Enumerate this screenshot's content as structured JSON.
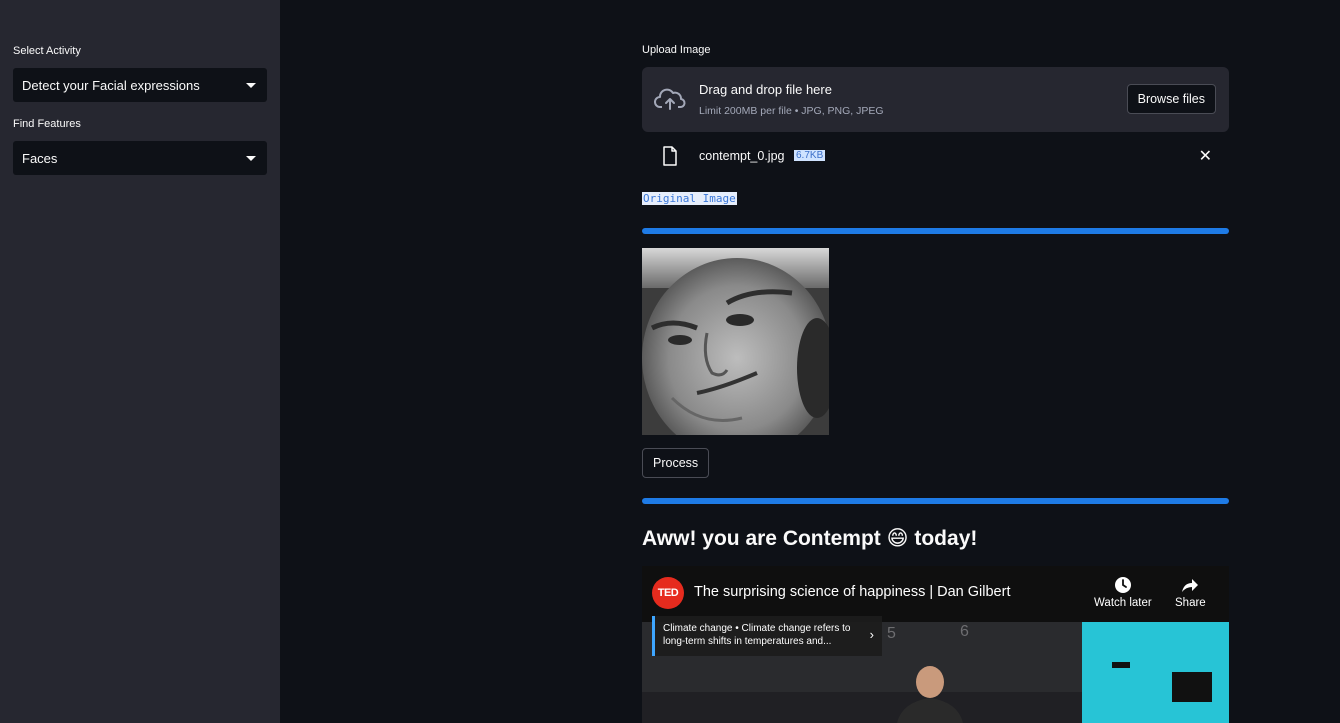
{
  "sidebar": {
    "activity_label": "Select Activity",
    "activity_value": "Detect your Facial expressions",
    "features_label": "Find Features",
    "features_value": "Faces"
  },
  "uploader": {
    "label": "Upload Image",
    "drop_title": "Drag and drop file here",
    "limit_text": "Limit 200MB per file • JPG, PNG, JPEG",
    "browse_label": "Browse files",
    "file_name": "contempt_0.jpg",
    "file_size": "6.7KB"
  },
  "original_label": "Original Image",
  "process_label": "Process",
  "result_text": "Aww! you are Contempt 😄 today!",
  "video": {
    "channel_logo": "TED",
    "title": "The surprising science of happiness | Dan Gilbert",
    "watch_later": "Watch later",
    "share": "Share",
    "card_text": "Climate change • Climate change refers to long-term shifts in temperatures and...",
    "scene_numbers": [
      "5",
      "6"
    ]
  },
  "icons": {
    "upload": "cloud-upload-icon",
    "file": "file-icon",
    "close": "close-icon",
    "caret": "chevron-down-icon",
    "clock": "clock-icon",
    "share": "share-icon"
  },
  "colors": {
    "background": "#0e1117",
    "sidebar": "#262730",
    "accent_bar": "#1e7be6",
    "ted_red": "#e62b1e"
  }
}
